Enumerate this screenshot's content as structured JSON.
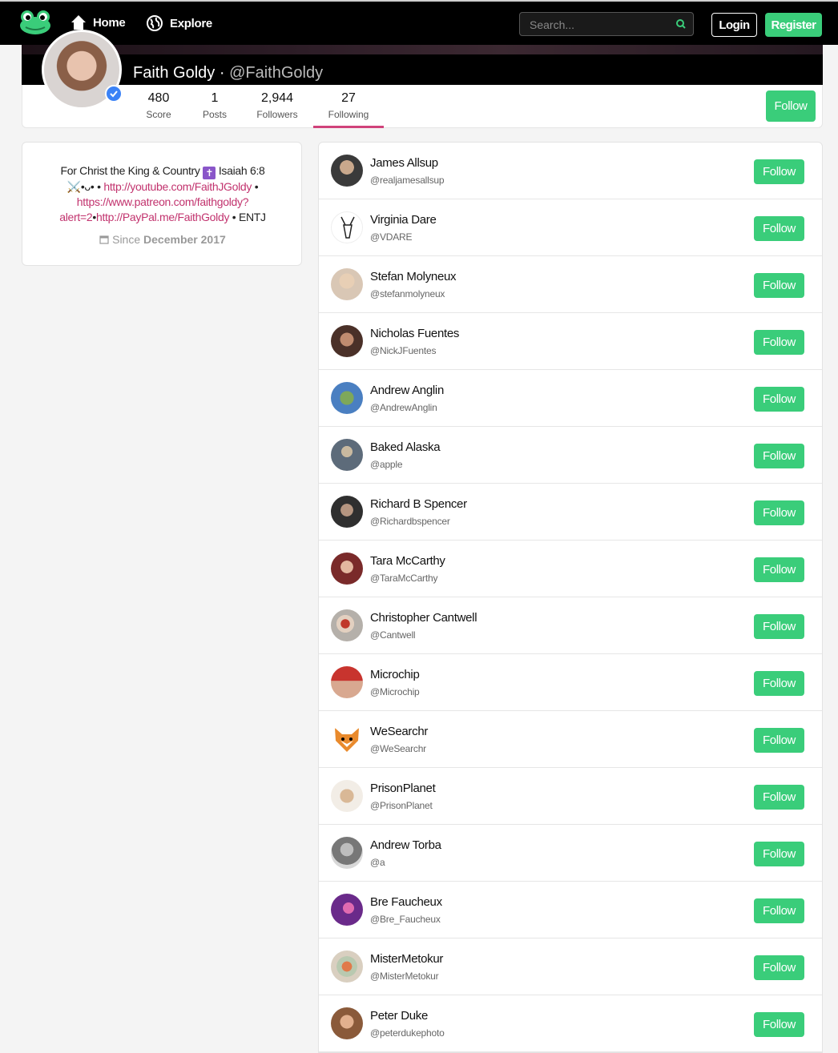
{
  "nav": {
    "home_label": "Home",
    "explore_label": "Explore",
    "search_placeholder": "Search...",
    "login_label": "Login",
    "register_label": "Register",
    "logo_icon": "frog-icon",
    "accent_color": "#3acd7a"
  },
  "profile": {
    "name": "Faith Goldy",
    "separator": "·",
    "handle": "@FaithGoldy",
    "verified_icon": "verified-check-icon",
    "follow_label": "Follow",
    "stats": [
      {
        "value": "480",
        "label": "Score"
      },
      {
        "value": "1",
        "label": "Posts"
      },
      {
        "value": "2,944",
        "label": "Followers"
      },
      {
        "value": "27",
        "label": "Following"
      }
    ],
    "active_tab": "Following",
    "active_color": "#d0427a"
  },
  "bio": {
    "line1_a": "For Christ the King & Country",
    "cross_glyph": "✝",
    "line1_b": "Isaiah 6:8",
    "line2_a": "⚔️•ᴗ•",
    "link1": "http://youtube.com/FaithJGoldy",
    "bullet": "•",
    "link2": "https://www.patreon.com/faithgoldy?alert=2",
    "link3": "http://PayPal.me/FaithGoldy",
    "tail": "• ENTJ",
    "since_prefix": "Since",
    "since_date": "December 2017",
    "calendar_icon": "calendar-icon"
  },
  "following": [
    {
      "name": "James Allsup",
      "handle": "@realjamesallsup",
      "follow_label": "Follow",
      "avatar_color": "#3a3a3a"
    },
    {
      "name": "Virginia Dare",
      "handle": "@VDARE",
      "follow_label": "Follow",
      "avatar_color": "#ffffff"
    },
    {
      "name": "Stefan Molyneux",
      "handle": "@stefanmolyneux",
      "follow_label": "Follow",
      "avatar_color": "#d9c7b5"
    },
    {
      "name": "Nicholas Fuentes",
      "handle": "@NickJFuentes",
      "follow_label": "Follow",
      "avatar_color": "#4a3028"
    },
    {
      "name": "Andrew Anglin",
      "handle": "@AndrewAnglin",
      "follow_label": "Follow",
      "avatar_color": "#4a7fc1"
    },
    {
      "name": "Baked Alaska",
      "handle": "@apple",
      "follow_label": "Follow",
      "avatar_color": "#5d6b7a"
    },
    {
      "name": "Richard B Spencer",
      "handle": "@Richardbspencer",
      "follow_label": "Follow",
      "avatar_color": "#2f2f2f"
    },
    {
      "name": "Tara McCarthy",
      "handle": "@TaraMcCarthy",
      "follow_label": "Follow",
      "avatar_color": "#7a2a2a"
    },
    {
      "name": "Christopher Cantwell",
      "handle": "@Cantwell",
      "follow_label": "Follow",
      "avatar_color": "#b5b0aa"
    },
    {
      "name": "Microchip",
      "handle": "@Microchip",
      "follow_label": "Follow",
      "avatar_color": "#c8342e"
    },
    {
      "name": "WeSearchr",
      "handle": "@WeSearchr",
      "follow_label": "Follow",
      "avatar_color": "#e98a2c"
    },
    {
      "name": "PrisonPlanet",
      "handle": "@PrisonPlanet",
      "follow_label": "Follow",
      "avatar_color": "#c9a27e"
    },
    {
      "name": "Andrew Torba",
      "handle": "@a",
      "follow_label": "Follow",
      "avatar_color": "#777777"
    },
    {
      "name": "Bre Faucheux",
      "handle": "@Bre_Faucheux",
      "follow_label": "Follow",
      "avatar_color": "#6a2a8a"
    },
    {
      "name": "MisterMetokur",
      "handle": "@MisterMetokur",
      "follow_label": "Follow",
      "avatar_color": "#b9c9b0"
    },
    {
      "name": "Peter Duke",
      "handle": "@peterdukephoto",
      "follow_label": "Follow",
      "avatar_color": "#8a5a3a"
    }
  ]
}
